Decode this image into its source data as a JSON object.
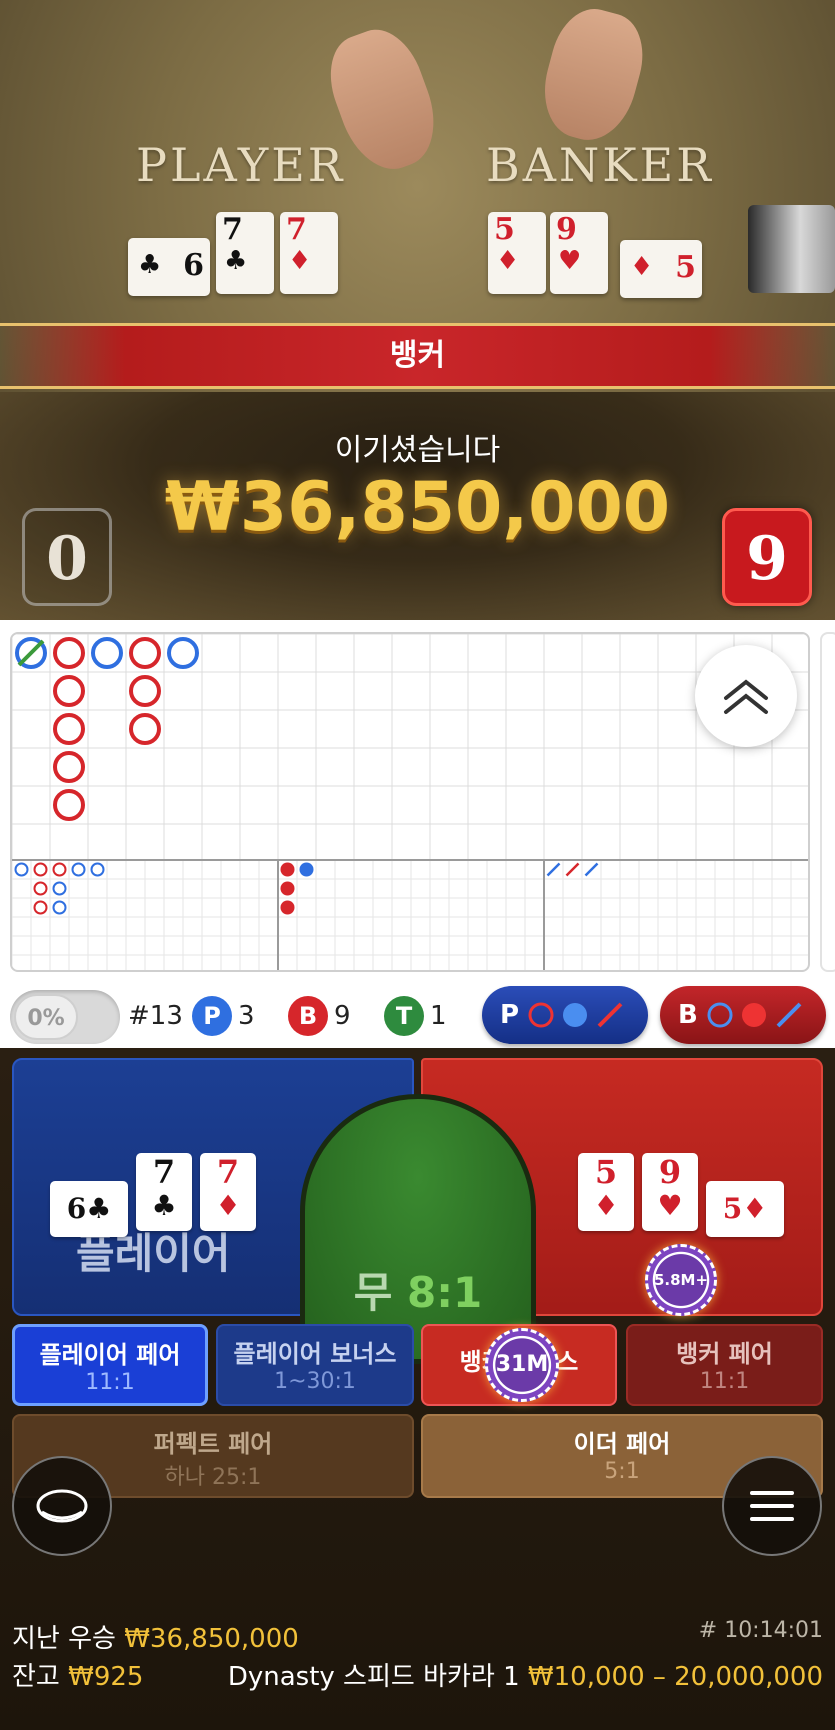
{
  "video": {
    "player_title": "PLAYER",
    "banker_title": "BANKER",
    "player_cards": [
      {
        "rank": "6",
        "suit": "♣",
        "color": "black",
        "sideways": true
      },
      {
        "rank": "7",
        "suit": "♣",
        "color": "black",
        "sideways": false
      },
      {
        "rank": "7",
        "suit": "♦",
        "color": "red",
        "sideways": false
      }
    ],
    "banker_cards": [
      {
        "rank": "5",
        "suit": "♦",
        "color": "red",
        "sideways": false
      },
      {
        "rank": "9",
        "suit": "♥",
        "color": "red",
        "sideways": false
      },
      {
        "rank": "5",
        "suit": "♦",
        "color": "red",
        "sideways": true
      }
    ]
  },
  "result": {
    "banner": "뱅커",
    "win_text": "이기셨습니다",
    "win_amount": "₩36,850,000",
    "player_score": "0",
    "banker_score": "9"
  },
  "roads": {
    "big_road": [
      {
        "col": 0,
        "row": 0,
        "type": "tie-player"
      },
      {
        "col": 1,
        "row": 0,
        "type": "B"
      },
      {
        "col": 1,
        "row": 1,
        "type": "B"
      },
      {
        "col": 1,
        "row": 2,
        "type": "B"
      },
      {
        "col": 1,
        "row": 3,
        "type": "B"
      },
      {
        "col": 1,
        "row": 4,
        "type": "B"
      },
      {
        "col": 2,
        "row": 0,
        "type": "P"
      },
      {
        "col": 3,
        "row": 0,
        "type": "B"
      },
      {
        "col": 3,
        "row": 1,
        "type": "B"
      },
      {
        "col": 3,
        "row": 2,
        "type": "B"
      },
      {
        "col": 4,
        "row": 0,
        "type": "P"
      }
    ],
    "big_eye": [
      {
        "col": 0,
        "row": 0,
        "color": "blue"
      },
      {
        "col": 1,
        "row": 0,
        "color": "red"
      },
      {
        "col": 2,
        "row": 0,
        "color": "red"
      },
      {
        "col": 3,
        "row": 0,
        "color": "blue"
      },
      {
        "col": 4,
        "row": 0,
        "color": "blue"
      },
      {
        "col": 1,
        "row": 1,
        "color": "red"
      },
      {
        "col": 2,
        "row": 1,
        "color": "blue"
      },
      {
        "col": 1,
        "row": 2,
        "color": "red"
      },
      {
        "col": 2,
        "row": 2,
        "color": "blue"
      }
    ],
    "small_road": [
      {
        "col": 0,
        "row": 0,
        "color": "red"
      },
      {
        "col": 1,
        "row": 0,
        "color": "blue"
      },
      {
        "col": 0,
        "row": 1,
        "color": "red"
      },
      {
        "col": 0,
        "row": 2,
        "color": "red"
      }
    ],
    "cockroach": [
      {
        "col": 0,
        "row": 0,
        "color": "blue"
      },
      {
        "col": 1,
        "row": 0,
        "color": "red"
      },
      {
        "col": 2,
        "row": 0,
        "color": "blue"
      }
    ]
  },
  "stats": {
    "percent_toggle": "0%",
    "round": "#13",
    "player": {
      "letter": "P",
      "count": "3",
      "color": "#2f6fe0"
    },
    "banker": {
      "letter": "B",
      "count": "9",
      "color": "#d6262b"
    },
    "tie": {
      "letter": "T",
      "count": "1",
      "color": "#2e8b3e"
    },
    "ask_player": "P",
    "ask_banker": "B"
  },
  "bets": {
    "player_label": "플레이어",
    "tie_label": "무",
    "tie_odds": "8:1",
    "banker_chip": "5.8M+",
    "player_pair": {
      "label": "플레이어 페어",
      "odds": "11:1"
    },
    "player_bonus": {
      "label": "플레이어 보너스",
      "odds": "1~30:1"
    },
    "banker_bonus": {
      "label": "뱅커 보너스",
      "chip": "31M"
    },
    "banker_pair": {
      "label": "뱅커 페어",
      "odds": "11:1"
    },
    "perfect_pair": {
      "label": "퍼펙트 페어",
      "odds": "하나 25:1"
    },
    "either_pair": {
      "label": "이더 페어",
      "odds": "5:1"
    }
  },
  "footer": {
    "last_win_label": "지난 우승",
    "last_win_value": "₩36,850,000",
    "round_time": "# 10:14:01",
    "balance_label": "잔고",
    "balance_value": "₩925",
    "table_name": "Dynasty 스피드 바카라 1",
    "limits": "₩10,000 – 20,000,000"
  },
  "colors": {
    "player_blue": "#1c3f94",
    "banker_red": "#c62a22",
    "tie_green": "#2f7a27",
    "gold": "#f2c13a"
  }
}
